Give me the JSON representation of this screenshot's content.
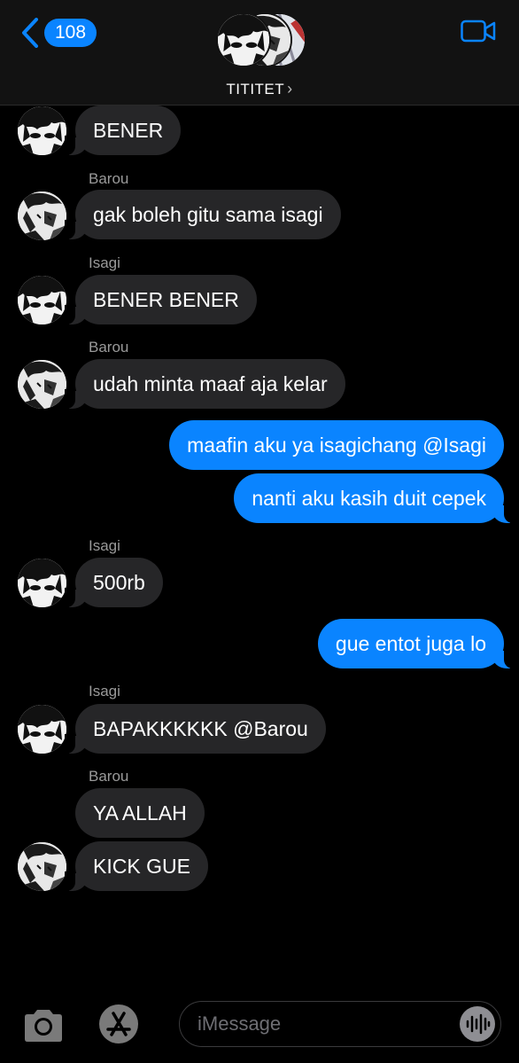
{
  "header": {
    "back_count": "108",
    "group_name": "TITITET",
    "chevron": "›",
    "back_icon": "chevron-left-icon",
    "video_icon": "video-camera-icon"
  },
  "messages": [
    {
      "sender": "",
      "text": "BENER",
      "direction": "incoming",
      "avatar": "isagi"
    },
    {
      "sender": "Barou",
      "text": "gak boleh gitu sama isagi",
      "direction": "incoming",
      "avatar": "barou"
    },
    {
      "sender": "Isagi",
      "text": "BENER BENER",
      "direction": "incoming",
      "avatar": "isagi"
    },
    {
      "sender": "Barou",
      "text": "udah minta maaf aja kelar",
      "direction": "incoming",
      "avatar": "barou"
    },
    {
      "sender": "",
      "text": "maafin aku ya isagichang @Isagi",
      "direction": "outgoing"
    },
    {
      "sender": "",
      "text": "nanti aku kasih duit cepek",
      "direction": "outgoing"
    },
    {
      "sender": "Isagi",
      "text": "500rb",
      "direction": "incoming",
      "avatar": "isagi"
    },
    {
      "sender": "",
      "text": "gue entot juga lo",
      "direction": "outgoing"
    },
    {
      "sender": "Isagi",
      "text": "BAPAKKKKKK @Barou",
      "direction": "incoming",
      "avatar": "isagi"
    },
    {
      "sender": "Barou",
      "text": "YA ALLAH",
      "direction": "incoming"
    },
    {
      "sender": "",
      "text": "KICK GUE",
      "direction": "incoming",
      "avatar": "barou"
    }
  ],
  "input": {
    "placeholder": "iMessage",
    "camera_icon": "camera-icon",
    "apps_icon": "app-store-icon",
    "audio_icon": "audio-waveform-icon"
  },
  "colors": {
    "background": "#000000",
    "header": "#121212",
    "incoming_bubble": "#262628",
    "outgoing_bubble": "#0a84ff",
    "sender_text": "#9a9a9a"
  }
}
